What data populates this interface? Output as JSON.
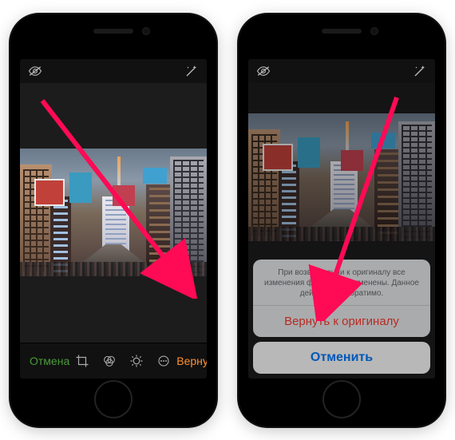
{
  "left": {
    "topbar": {
      "visibility_icon": "eye-off-icon",
      "wand_icon": "magic-wand-icon"
    },
    "bottombar": {
      "cancel_label": "Отмена",
      "revert_label": "Вернуть",
      "tools": {
        "crop": "crop-icon",
        "filters": "filters-icon",
        "adjust": "adjust-icon",
        "more": "more-icon"
      }
    }
  },
  "right": {
    "topbar": {
      "visibility_icon": "eye-off-icon",
      "wand_icon": "magic-wand-icon"
    },
    "action_sheet": {
      "message": "При возвращении к оригиналу все изменения фото будут отменены. Данное действие необратимо.",
      "revert_label": "Вернуть к оригиналу",
      "cancel_label": "Отменить"
    }
  }
}
